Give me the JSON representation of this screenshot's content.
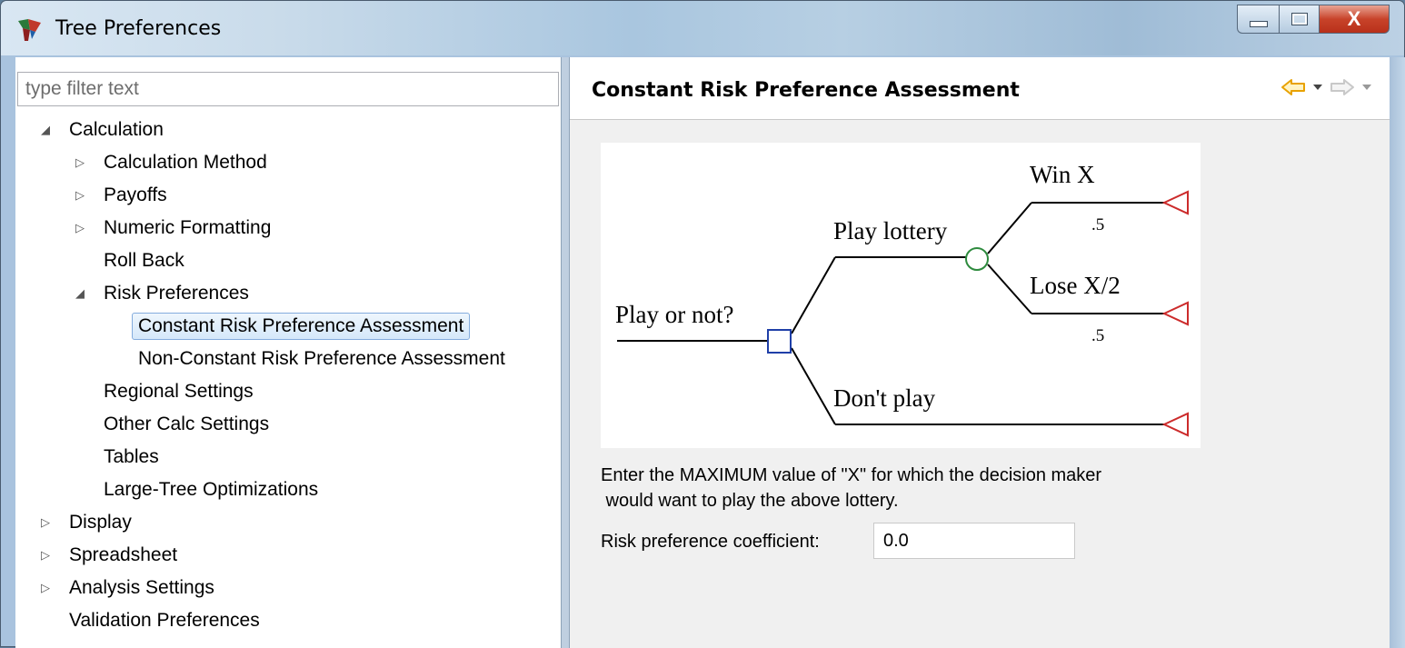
{
  "window": {
    "title": "Tree Preferences",
    "close_label": "X"
  },
  "filter": {
    "placeholder": "type filter text"
  },
  "tree": {
    "items": [
      {
        "label": "Calculation",
        "level": 0,
        "expander": "expanded"
      },
      {
        "label": "Calculation Method",
        "level": 1,
        "expander": "collapsed"
      },
      {
        "label": "Payoffs",
        "level": 1,
        "expander": "collapsed"
      },
      {
        "label": "Numeric Formatting",
        "level": 1,
        "expander": "collapsed"
      },
      {
        "label": "Roll Back",
        "level": 1,
        "expander": "none"
      },
      {
        "label": "Risk Preferences",
        "level": 1,
        "expander": "expanded"
      },
      {
        "label": "Constant Risk Preference Assessment",
        "level": 2,
        "expander": "none",
        "selected": true
      },
      {
        "label": "Non-Constant Risk Preference Assessment",
        "level": 2,
        "expander": "none"
      },
      {
        "label": "Regional Settings",
        "level": 1,
        "expander": "none"
      },
      {
        "label": "Other Calc Settings",
        "level": 1,
        "expander": "none"
      },
      {
        "label": "Tables",
        "level": 1,
        "expander": "none"
      },
      {
        "label": "Large-Tree Optimizations",
        "level": 1,
        "expander": "none"
      },
      {
        "label": "Display",
        "level": 0,
        "expander": "collapsed"
      },
      {
        "label": "Spreadsheet",
        "level": 0,
        "expander": "collapsed"
      },
      {
        "label": "Analysis Settings",
        "level": 0,
        "expander": "collapsed"
      },
      {
        "label": "Validation Preferences",
        "level": 0,
        "expander": "none"
      }
    ]
  },
  "page": {
    "title": "Constant Risk Preference Assessment",
    "diagram": {
      "decision_label": "Play or not?",
      "branch_play": "Play lottery",
      "branch_dont": "Don't play",
      "outcome_win": "Win X",
      "outcome_lose": "Lose X/2",
      "prob_win": ".5",
      "prob_lose": ".5",
      "colors": {
        "decision_node": "#1f3fa8",
        "chance_node": "#2e8b3e",
        "terminal_node": "#cc2b2b"
      }
    },
    "instruction_line1": "Enter the MAXIMUM value of \"X\" for which the decision maker",
    "instruction_line2": " would want to play the above lottery.",
    "coefficient_label": "Risk preference coefficient:",
    "coefficient_value": "0.0"
  },
  "colors": {
    "nav_back_arrow": "#e8a200",
    "nav_forward_arrow": "#c8c8c8"
  }
}
